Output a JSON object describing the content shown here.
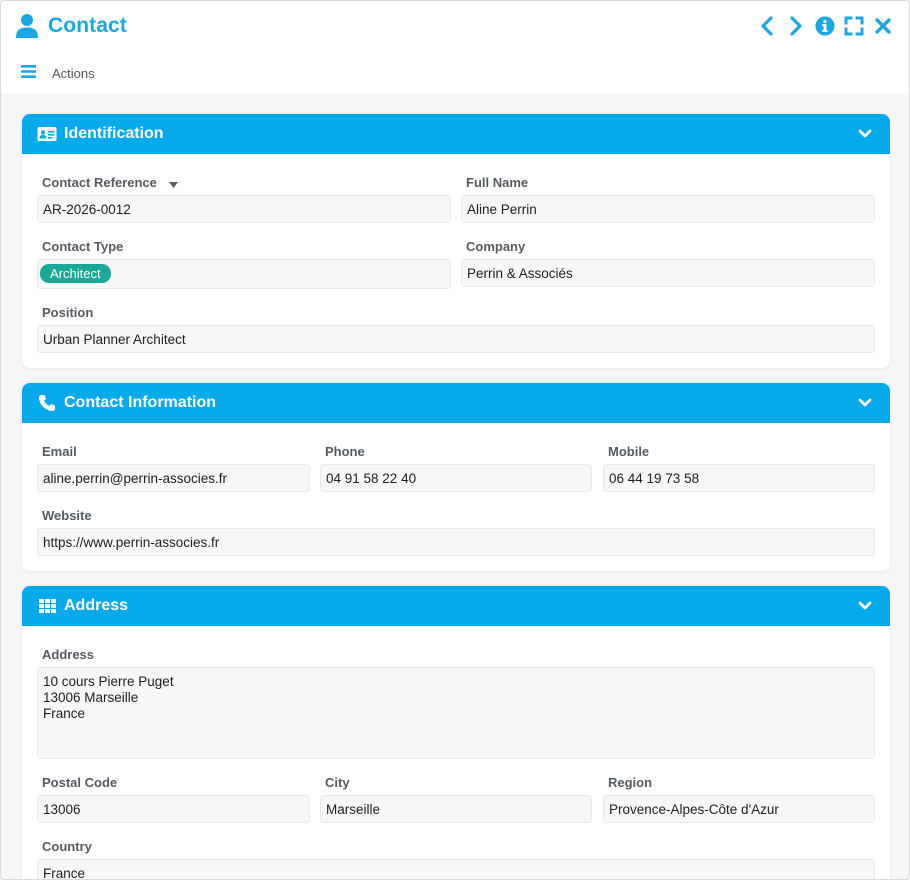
{
  "header": {
    "title": "Contact",
    "actions_label": "Actions",
    "accent": "#1ba7e6",
    "controls": [
      "chevron-left-icon",
      "chevron-right-icon",
      "info-icon",
      "expand-icon",
      "close-icon"
    ]
  },
  "identification": {
    "title": "Identification",
    "reference_label": "Contact Reference",
    "reference_value": "AR-2026-0012",
    "fullname_label": "Full Name",
    "fullname_value": "Aline Perrin",
    "type_label": "Contact Type",
    "type_value": "Architect",
    "company_label": "Company",
    "company_value": "Perrin & Associés",
    "position_label": "Position",
    "position_value": "Urban Planner Architect"
  },
  "contact_info": {
    "title": "Contact Information",
    "email_label": "Email",
    "email_value": "aline.perrin@perrin-associes.fr",
    "phone_label": "Phone",
    "phone_value": "04 91 58 22 40",
    "mobile_label": "Mobile",
    "mobile_value": "06 44 19 73 58",
    "website_label": "Website",
    "website_value": "https://www.perrin-associes.fr"
  },
  "address": {
    "title": "Address",
    "address_label": "Address",
    "address_value": "10 cours Pierre Puget\n13006 Marseille\nFrance",
    "postal_label": "Postal Code",
    "postal_value": "13006",
    "city_label": "City",
    "city_value": "Marseille",
    "region_label": "Region",
    "region_value": "Provence-Alpes-Côte d'Azur",
    "country_label": "Country",
    "country_value": "France"
  },
  "colors": {
    "panel_header": "#06aaea",
    "tag": "#1aa897"
  }
}
